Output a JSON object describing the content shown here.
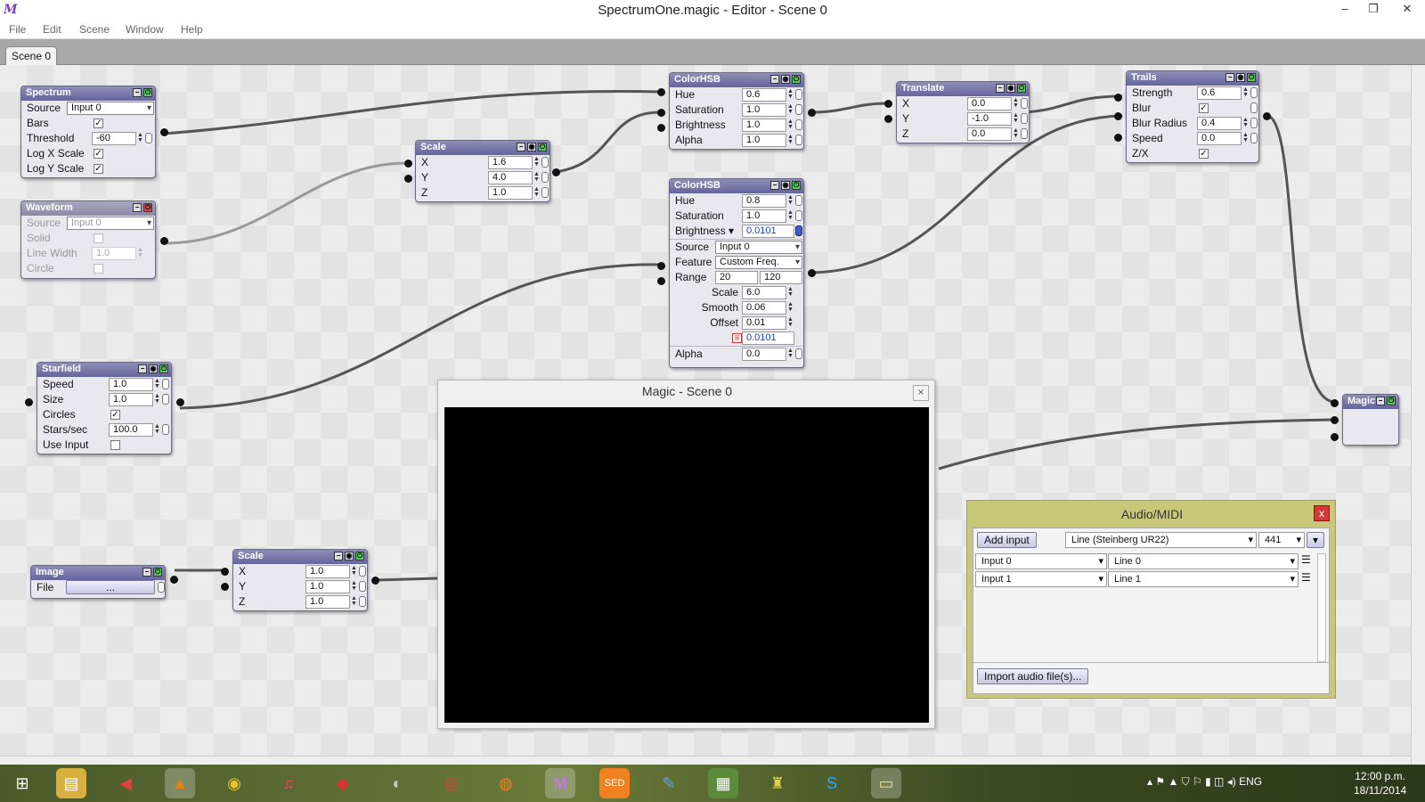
{
  "window": {
    "title": "SpectrumOne.magic - Editor - Scene 0",
    "logo": "M",
    "minimize": "–",
    "restore": "❐",
    "close": "✕"
  },
  "menu": [
    "File",
    "Edit",
    "Scene",
    "Window",
    "Help"
  ],
  "tab": "Scene 0",
  "nodes": {
    "spectrum": {
      "title": "Spectrum",
      "rows": {
        "source": "Source",
        "bars": "Bars",
        "threshold": "Threshold",
        "logx": "Log X Scale",
        "logy": "Log Y Scale"
      },
      "source_value": "Input 0",
      "threshold_value": "-60"
    },
    "waveform": {
      "title": "Waveform",
      "rows": {
        "source": "Source",
        "solid": "Solid",
        "linewidth": "Line Width",
        "circle": "Circle"
      },
      "source_value": "Input 0",
      "linewidth_value": "1.0"
    },
    "starfield": {
      "title": "Starfield",
      "rows": {
        "speed": "Speed",
        "size": "Size",
        "circles": "Circles",
        "stars": "Stars/sec",
        "useinput": "Use Input"
      },
      "speed_value": "1.0",
      "size_value": "1.0",
      "stars_value": "100.0"
    },
    "image": {
      "title": "Image",
      "file_label": "File",
      "file_value": "..."
    },
    "scale1": {
      "title": "Scale",
      "x": "1.6",
      "y": "4.0",
      "z": "1.0"
    },
    "scale2": {
      "title": "Scale",
      "x": "1.0",
      "y": "1.0",
      "z": "1.0"
    },
    "axis": {
      "x": "X",
      "y": "Y",
      "z": "Z"
    },
    "colorhsb1": {
      "title": "ColorHSB",
      "hue": "0.6",
      "saturation": "1.0",
      "brightness": "1.0",
      "alpha": "1.0"
    },
    "colorhsb2": {
      "title": "ColorHSB",
      "hue": "0.8",
      "saturation": "1.0",
      "brightness": "0.0101",
      "source": "Input 0",
      "feature": "Custom Freq.",
      "range_lo": "20",
      "range_hi": "120",
      "scale": "6.0",
      "smooth": "0.06",
      "offset": "0.01",
      "result": "0.0101",
      "alpha": "0.0",
      "brightness_label": "Brightness ▾"
    },
    "hsb_labels": {
      "hue": "Hue",
      "saturation": "Saturation",
      "brightness": "Brightness",
      "alpha": "Alpha",
      "source": "Source",
      "feature": "Feature",
      "range": "Range",
      "scale": "Scale",
      "smooth": "Smooth",
      "offset": "Offset"
    },
    "translate": {
      "title": "Translate",
      "x": "0.0",
      "y": "-1.0",
      "z": "0.0"
    },
    "trails": {
      "title": "Trails",
      "labels": {
        "strength": "Strength",
        "blur": "Blur",
        "blur_radius": "Blur Radius",
        "speed": "Speed",
        "zx": "Z/X"
      },
      "strength": "0.6",
      "blur_radius": "0.4",
      "speed": "0.0"
    },
    "magic": {
      "title": "Magic"
    }
  },
  "viewer": {
    "title": "Magic - Scene 0",
    "close": "×"
  },
  "audio": {
    "title": "Audio/MIDI",
    "close": "x",
    "add_input": "Add input",
    "device": "Line (Steinberg UR22)",
    "rate": "441",
    "inputs": [
      {
        "name": "Input 0",
        "line": "Line 0"
      },
      {
        "name": "Input 1",
        "line": "Line 1"
      }
    ],
    "import": "Import audio file(s)..."
  },
  "tray": {
    "lang": "ENG",
    "time": "12:00 p.m.",
    "date": "18/11/2014"
  },
  "colors": {
    "node_header": "#7474aa",
    "audio_bg": "#c8c878",
    "link": "#555555"
  }
}
